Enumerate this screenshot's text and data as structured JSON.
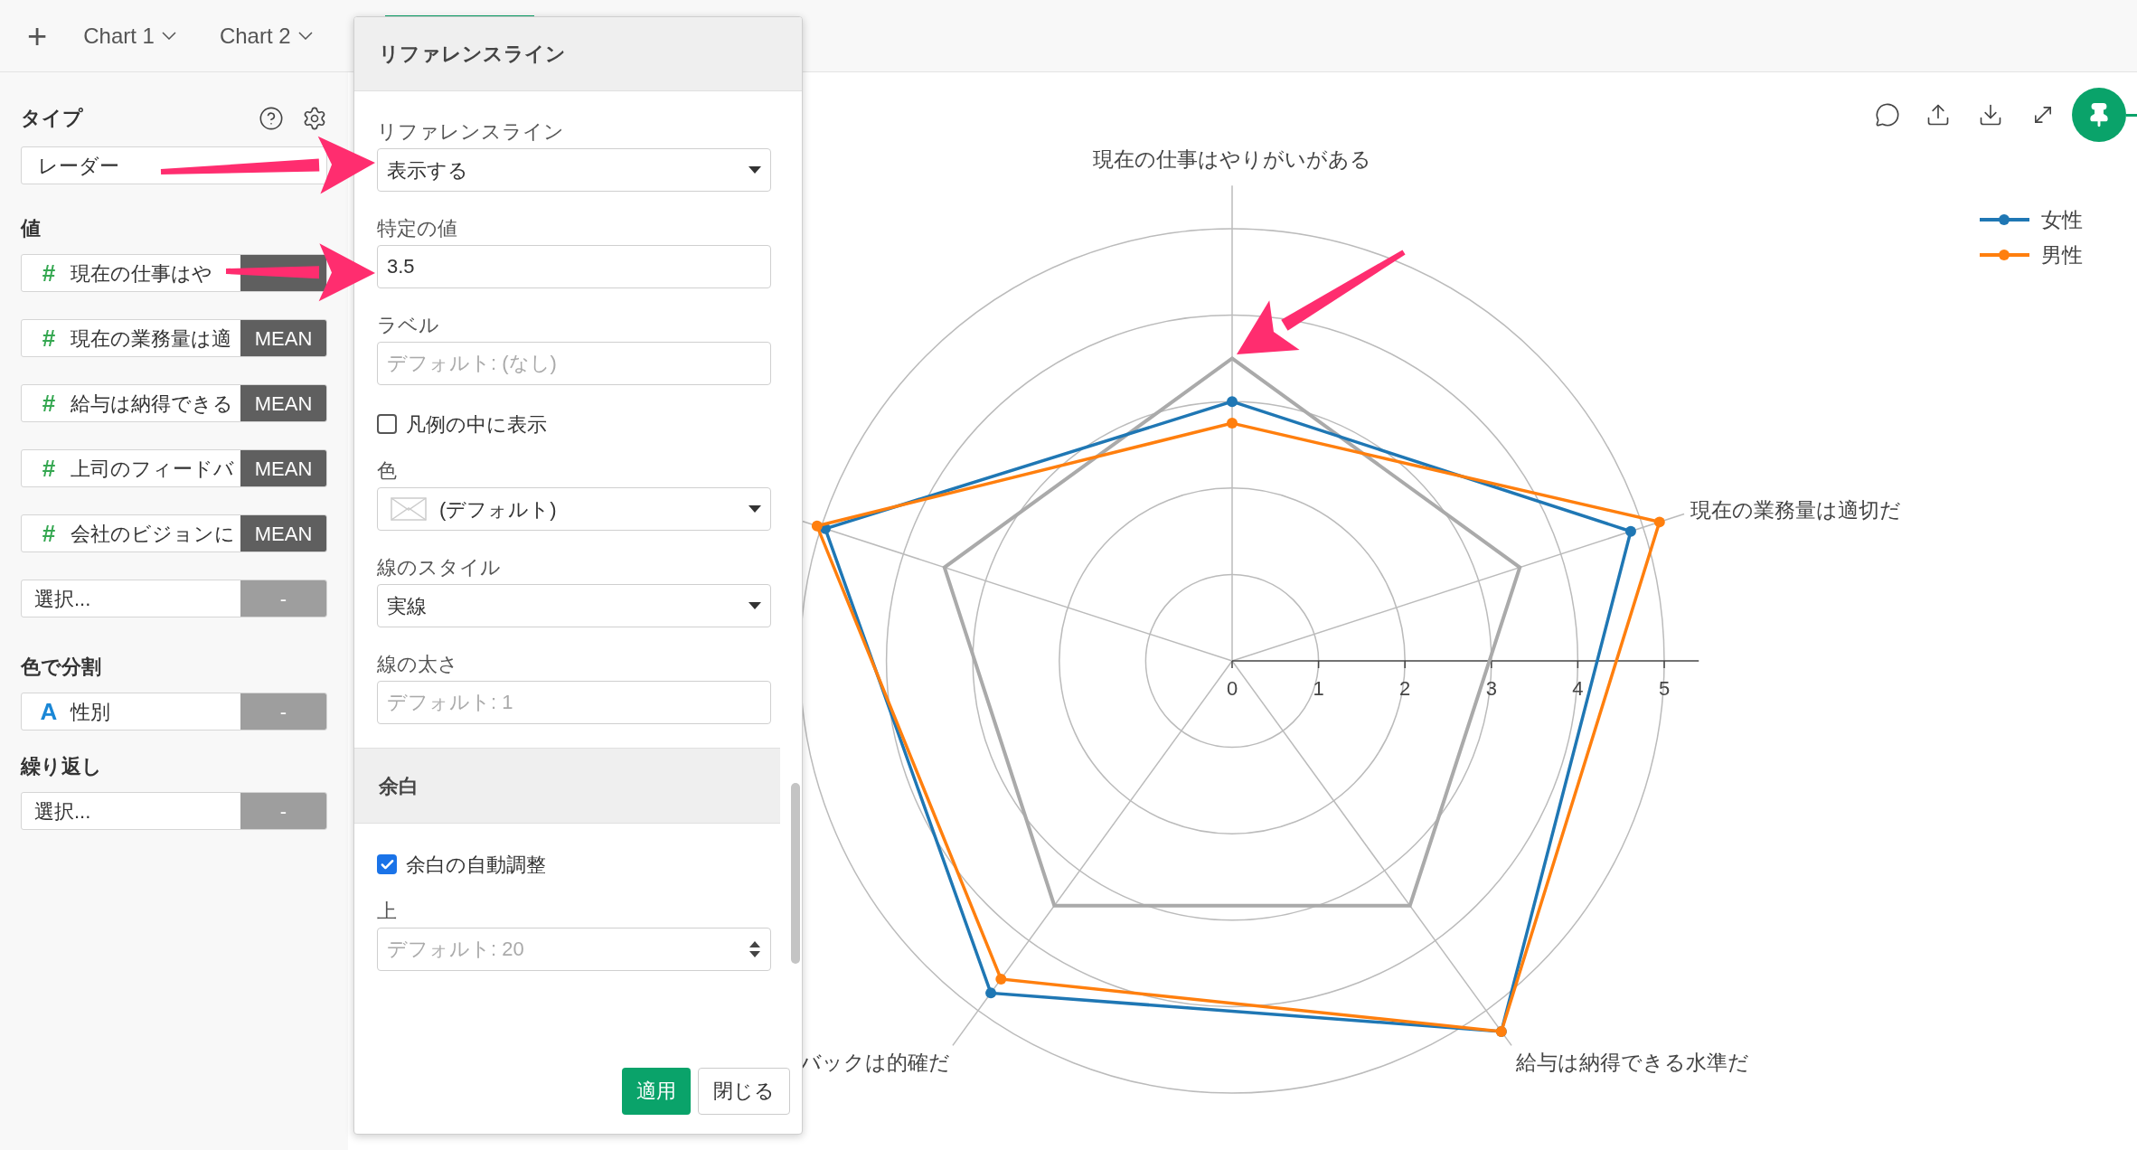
{
  "tabs": [
    {
      "kind": "add",
      "label": "+"
    },
    {
      "kind": "chart",
      "label": "Chart 1"
    },
    {
      "kind": "chart",
      "label": "Chart 2"
    }
  ],
  "sidebar": {
    "type_section": {
      "title": "タイプ",
      "value": "レーダー"
    },
    "values_section": {
      "title": "値",
      "items": [
        {
          "glyph": "#",
          "label": "現在の仕事はや"
        },
        {
          "glyph": "#",
          "label": "現在の業務量は適",
          "aggregate": "MEAN"
        },
        {
          "glyph": "#",
          "label": "給与は納得できる",
          "aggregate": "MEAN"
        },
        {
          "glyph": "#",
          "label": "上司のフィードバ",
          "aggregate": "MEAN"
        },
        {
          "glyph": "#",
          "label": "会社のビジョンに",
          "aggregate": "MEAN"
        }
      ],
      "add": {
        "label": "選択...",
        "button": "-"
      }
    },
    "color_section": {
      "title": "色で分割",
      "item": {
        "glyph": "A",
        "label": "性別",
        "button": "-"
      }
    },
    "repeat_section": {
      "title": "繰り返し",
      "add": {
        "label": "選択...",
        "button": "-"
      }
    }
  },
  "dialog": {
    "title": "リファレンスライン",
    "fields": [
      {
        "kind": "select",
        "label": "リファレンスライン",
        "value": "表示する"
      },
      {
        "kind": "input",
        "label": "特定の値",
        "value": "3.5"
      },
      {
        "kind": "input",
        "label": "ラベル",
        "placeholder": "デフォルト: (なし)"
      },
      {
        "kind": "checkbox",
        "label": "凡例の中に表示",
        "checked": false
      },
      {
        "kind": "color",
        "label": "色",
        "selection": "(デフォルト)"
      },
      {
        "kind": "select",
        "label": "線のスタイル",
        "value": "実線"
      },
      {
        "kind": "input",
        "label": "線の太さ",
        "placeholder": "デフォルト: 1"
      }
    ],
    "section": {
      "title": "余白",
      "fields": [
        {
          "kind": "checkbox",
          "label": "余白の自動調整",
          "checked": true
        },
        {
          "kind": "number",
          "label": "上",
          "placeholder": "デフォルト: 20"
        }
      ]
    },
    "buttons": [
      {
        "label": "適用",
        "primary": true
      },
      {
        "label": "閉じる",
        "primary": false
      }
    ]
  },
  "chart": {
    "axis_labels": [
      {
        "kind": "top",
        "text": "現在の仕事はやりがいがある"
      },
      {
        "kind": "right",
        "text": "現在の業務量は適切だ"
      },
      {
        "kind": "bottom_left",
        "text": "バックは的確だ"
      },
      {
        "kind": "bottom_right",
        "text": "給与は納得できる水準だ"
      }
    ],
    "ticks": [
      "0",
      "1",
      "2",
      "3",
      "4",
      "5"
    ],
    "legend": [
      {
        "name": "女性",
        "color": "#1f77b4"
      },
      {
        "name": "男性",
        "color": "#ff7f0e"
      }
    ]
  }
}
